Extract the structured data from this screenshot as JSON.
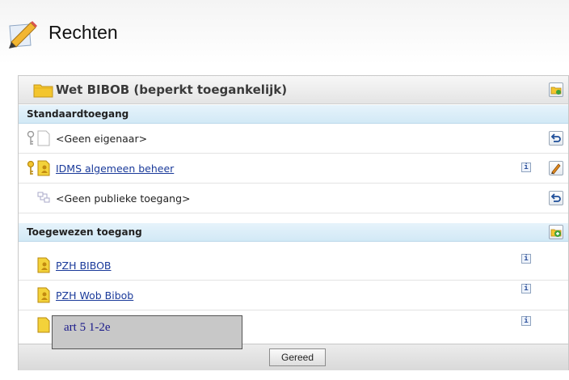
{
  "header": {
    "title": "Rechten",
    "icon": "pencil-edit-icon"
  },
  "panel": {
    "title": "Wet BIBOB (beperkt toegankelijk)",
    "title_icon": "folder-icon",
    "head_action_icon": "folder-share-icon"
  },
  "sections": {
    "standaard": "Standaardtoegang",
    "toegewezen": "Toegewezen toegang"
  },
  "standard_rows": [
    {
      "label": "<Geen eigenaar>",
      "is_link": false,
      "icon": "empty-document-icon",
      "key": "key-grey-icon",
      "actions": [
        "undo-icon"
      ]
    },
    {
      "label": "IDMS algemeen beheer",
      "is_link": true,
      "icon": "group-icon",
      "key": "key-yellow-icon",
      "actions": [
        "info-icon",
        "edit-icon"
      ]
    },
    {
      "label": "<Geen publieke toegang>",
      "is_link": false,
      "icon": "network-icon",
      "actions": [
        "undo-icon"
      ]
    }
  ],
  "assigned_rows": [
    {
      "label": "PZH BIBOB",
      "is_link": true,
      "icon": "group-icon",
      "actions": [
        "info-icon"
      ]
    },
    {
      "label": "PZH Wob Bibob",
      "is_link": true,
      "icon": "group-icon",
      "actions": [
        "info-icon"
      ]
    },
    {
      "label": "",
      "is_link": true,
      "icon": "group-icon",
      "actions": [
        "info-icon"
      ]
    }
  ],
  "tooltip": {
    "text": "art 5 1-2e"
  },
  "footer": {
    "done_label": "Gereed"
  },
  "colors": {
    "section_bg": "#d6ebf7",
    "link": "#1a3a9a",
    "folder": "#f3c52e"
  }
}
